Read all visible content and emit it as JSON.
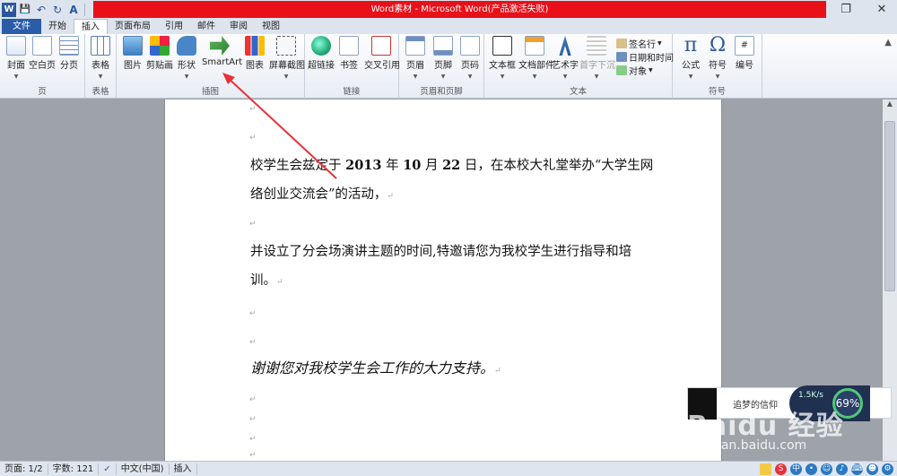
{
  "window": {
    "title": "Word素材 - Microsoft Word(产品激活失败)",
    "restore_glyph": "❐",
    "close_glyph": "✕"
  },
  "quick_access": {
    "icons": [
      "word-logo-icon",
      "save-icon",
      "undo-icon",
      "redo-icon",
      "spellcheck-icon",
      "customize-icon"
    ],
    "glyphs": [
      "W",
      "💾",
      "↶",
      "↻",
      "A",
      "▾"
    ]
  },
  "tabs": [
    "文件",
    "开始",
    "插入",
    "页面布局",
    "引用",
    "邮件",
    "审阅",
    "视图"
  ],
  "active_tab": "插入",
  "ribbon": {
    "groups": {
      "pages": "页",
      "tables": "表格",
      "illustrations": "插图",
      "links": "链接",
      "header_footer": "页眉和页脚",
      "text": "文本",
      "symbols": "符号"
    },
    "buttons": {
      "cover": "封面",
      "blank_page": "空白页",
      "page_break": "分页",
      "table": "表格",
      "picture": "图片",
      "clip_art": "剪贴画",
      "shapes": "形状",
      "smartart": "SmartArt",
      "chart": "图表",
      "screenshot": "屏幕截图",
      "hyperlink": "超链接",
      "bookmark": "书签",
      "cross_ref": "交叉引用",
      "header": "页眉",
      "footer": "页脚",
      "page_number": "页码",
      "text_box": "文本框",
      "quick_parts": "文档部件",
      "wordart": "艺术字",
      "drop_cap": "首字下沉",
      "signature": "签名行",
      "date_time": "日期和时间",
      "object": "对象",
      "equation": "公式",
      "symbol": "符号",
      "number": "编号"
    }
  },
  "document": {
    "para1_prefix": "校学生会兹定于 ",
    "para1_year": "2013",
    "para1_y_suffix": " 年 ",
    "para1_month": "10",
    "para1_m_suffix": " 月 ",
    "para1_day": "22",
    "para1_rest": " 日，在本校大礼堂举办“大学生网",
    "para1_line2": "络创业交流会”的活动，",
    "para2_line1": "并设立了分会场演讲主题的时间,特邀请您为我校学生进行指导和培",
    "para2_line2": "训。",
    "para3": "谢谢您对我校学生会工作的大力支持。",
    "para_mark": "↵"
  },
  "statusbar": {
    "page": "页面: 1/2",
    "words": "字数: 121",
    "language": "中文(中国)",
    "mode": "插入"
  },
  "overlays": {
    "music_text": "追梦的信仰",
    "speed": "1.5K/s",
    "percent": "69%",
    "watermark": "Baidu 经验",
    "watermark_url": "jingyan.baidu.com"
  }
}
